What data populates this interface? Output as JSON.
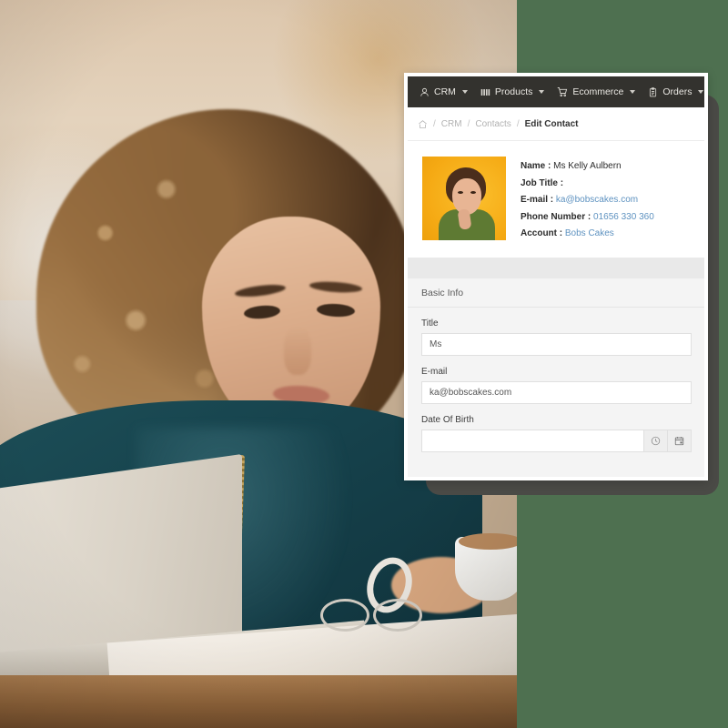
{
  "background_photo": {
    "description": "Woman with curly hair working on a laptop in a cafe",
    "alt": "Woman with curly hair using laptop at cafe table with coffee cup"
  },
  "theme": {
    "page_background": "#4e7050",
    "navbar_background": "#33322e",
    "device_frame": "#4a4a46",
    "link_color": "#5e92c0",
    "avatar_background": "#f5b21c",
    "form_background": "#f4f4f4"
  },
  "navbar": {
    "items": [
      {
        "label": "CRM",
        "icon": "user-icon",
        "caret": true
      },
      {
        "label": "Products",
        "icon": "bars-icon",
        "caret": true
      },
      {
        "label": "Ecommerce",
        "icon": "cart-icon",
        "caret": true
      },
      {
        "label": "Orders",
        "icon": "clipboard-icon",
        "caret": true
      },
      {
        "label": "",
        "icon": "megaphone-icon",
        "caret": false
      }
    ]
  },
  "breadcrumb": {
    "home_icon": "home-icon",
    "items": [
      {
        "label": "CRM",
        "current": false
      },
      {
        "label": "Contacts",
        "current": false
      },
      {
        "label": "Edit Contact",
        "current": true
      }
    ],
    "separator": "/"
  },
  "contact": {
    "avatar_alt": "Portrait of Kelly Aulbern on yellow background",
    "fields": [
      {
        "label": "Name :",
        "value": "Ms Kelly Aulbern",
        "link": false
      },
      {
        "label": "Job Title :",
        "value": "",
        "link": false
      },
      {
        "label": "E-mail :",
        "value": "ka@bobscakes.com",
        "link": true
      },
      {
        "label": "Phone Number :",
        "value": "01656 330 360",
        "link": true
      },
      {
        "label": "Account :",
        "value": "Bobs Cakes",
        "link": true
      }
    ]
  },
  "form": {
    "section_title": "Basic Info",
    "fields": [
      {
        "label": "Title",
        "value": "Ms",
        "placeholder": "",
        "name": "title",
        "addons": []
      },
      {
        "label": "E-mail",
        "value": "ka@bobscakes.com",
        "placeholder": "",
        "name": "email",
        "addons": []
      },
      {
        "label": "Date Of Birth",
        "value": "",
        "placeholder": "",
        "name": "date-of-birth",
        "addons": [
          "clock-icon",
          "calendar-icon"
        ]
      }
    ]
  }
}
